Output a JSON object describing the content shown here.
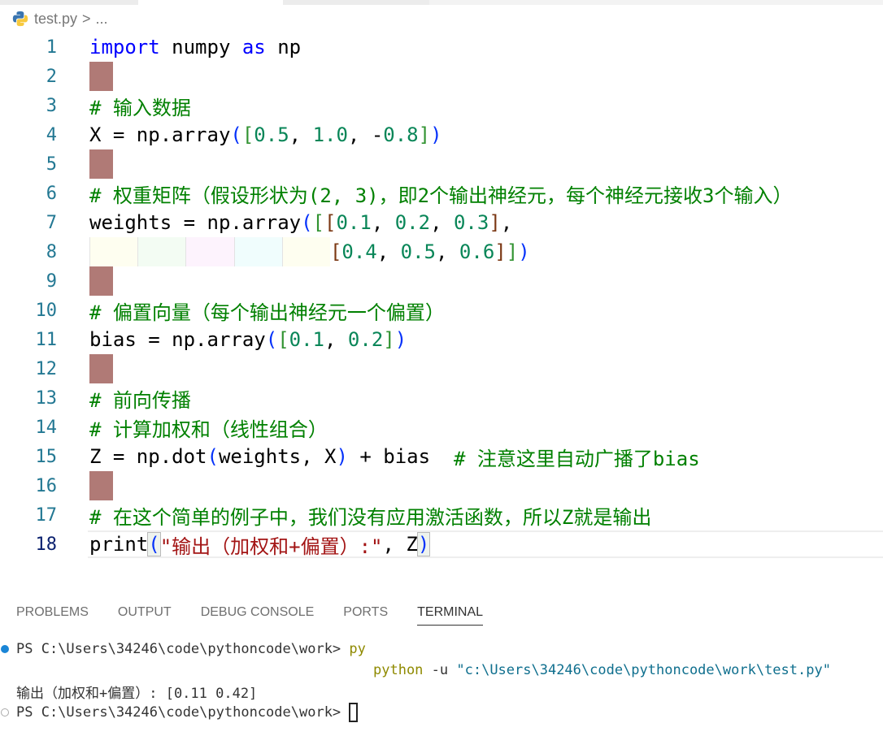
{
  "breadcrumb": {
    "file": "test.py",
    "sep": ">",
    "more": "..."
  },
  "editor": {
    "lines": [
      {
        "n": "1",
        "t": [
          [
            "import",
            "kw"
          ],
          [
            " numpy ",
            "tx"
          ],
          [
            "as",
            "kw"
          ],
          [
            " np",
            "tx"
          ]
        ]
      },
      {
        "n": "2",
        "empty": true
      },
      {
        "n": "3",
        "t": [
          [
            "# 输入数据",
            "cm"
          ]
        ]
      },
      {
        "n": "4",
        "t": [
          [
            "X = np.array",
            "tx"
          ],
          [
            "(",
            "b1"
          ],
          [
            "[",
            "b2"
          ],
          [
            "0.5",
            "num"
          ],
          [
            ", ",
            "tx"
          ],
          [
            "1.0",
            "num"
          ],
          [
            ", -",
            "tx"
          ],
          [
            "0.8",
            "num"
          ],
          [
            "]",
            "b2"
          ],
          [
            ")",
            "b1"
          ]
        ]
      },
      {
        "n": "5",
        "empty": true
      },
      {
        "n": "6",
        "t": [
          [
            "# 权重矩阵（假设形状为(2, 3)，即2个输出神经元，每个神经元接收3个输入）",
            "cm"
          ]
        ]
      },
      {
        "n": "7",
        "t": [
          [
            "weights = np.array",
            "tx"
          ],
          [
            "(",
            "b1"
          ],
          [
            "[",
            "b2"
          ],
          [
            "[",
            "b3"
          ],
          [
            "0.1",
            "num"
          ],
          [
            ", ",
            "tx"
          ],
          [
            "0.2",
            "num"
          ],
          [
            ", ",
            "tx"
          ],
          [
            "0.3",
            "num"
          ],
          [
            "]",
            "b3"
          ],
          [
            ",",
            "tx"
          ]
        ]
      },
      {
        "n": "8",
        "indent": true,
        "t": [
          [
            "[",
            "b3"
          ],
          [
            "0.4",
            "num"
          ],
          [
            ", ",
            "tx"
          ],
          [
            "0.5",
            "num"
          ],
          [
            ", ",
            "tx"
          ],
          [
            "0.6",
            "num"
          ],
          [
            "]",
            "b3"
          ],
          [
            "]",
            "b2"
          ],
          [
            ")",
            "b1"
          ]
        ]
      },
      {
        "n": "9",
        "empty": true
      },
      {
        "n": "10",
        "t": [
          [
            "# 偏置向量（每个输出神经元一个偏置）",
            "cm"
          ]
        ]
      },
      {
        "n": "11",
        "t": [
          [
            "bias = np.array",
            "tx"
          ],
          [
            "(",
            "b1"
          ],
          [
            "[",
            "b2"
          ],
          [
            "0.1",
            "num"
          ],
          [
            ", ",
            "tx"
          ],
          [
            "0.2",
            "num"
          ],
          [
            "]",
            "b2"
          ],
          [
            ")",
            "b1"
          ]
        ]
      },
      {
        "n": "12",
        "empty": true
      },
      {
        "n": "13",
        "t": [
          [
            "# 前向传播",
            "cm"
          ]
        ]
      },
      {
        "n": "14",
        "t": [
          [
            "# 计算加权和（线性组合）",
            "cm"
          ]
        ]
      },
      {
        "n": "15",
        "t": [
          [
            "Z = np.dot",
            "tx"
          ],
          [
            "(",
            "b1"
          ],
          [
            "weights, X",
            "tx"
          ],
          [
            ")",
            "b1"
          ],
          [
            " + bias  ",
            "tx"
          ],
          [
            "# 注意这里自动广播了bias",
            "cm"
          ]
        ]
      },
      {
        "n": "16",
        "empty": true
      },
      {
        "n": "17",
        "t": [
          [
            "# 在这个简单的例子中，我们没有应用激活函数，所以Z就是输出",
            "cm"
          ]
        ]
      },
      {
        "n": "18",
        "current": true,
        "t": [
          [
            "print",
            "tx"
          ],
          [
            "(",
            "b1 match"
          ],
          [
            "\"输出（加权和+偏置）:\"",
            "str"
          ],
          [
            ", Z",
            "tx"
          ],
          [
            ")",
            "b1 match"
          ]
        ]
      }
    ]
  },
  "panel": {
    "tabs": [
      "PROBLEMS",
      "OUTPUT",
      "DEBUG CONSOLE",
      "PORTS",
      "TERMINAL"
    ],
    "active": "TERMINAL"
  },
  "terminal": {
    "prompt": "PS C:\\Users\\34246\\code\\pythoncode\\work> ",
    "cmd1": "py",
    "cmd2_a": "python",
    "cmd2_b": " -u ",
    "cmd2_c": "\"c:\\Users\\34246\\code\\pythoncode\\work\\test.py\"",
    "output": "输出（加权和+偏置）: [0.11 0.42]"
  }
}
